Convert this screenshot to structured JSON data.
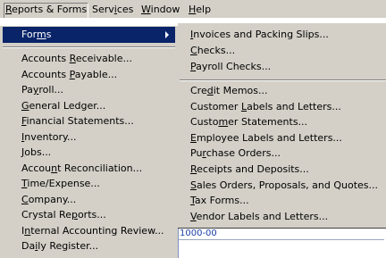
{
  "menubar": {
    "items": [
      {
        "label": "Reports & Forms",
        "underline_index": 0,
        "open": true
      },
      {
        "label": "Services",
        "underline_index": 4,
        "open": false
      },
      {
        "label": "Window",
        "underline_index": 0,
        "open": false
      },
      {
        "label": "Help",
        "underline_index": 0,
        "open": false
      }
    ]
  },
  "reports_menu": {
    "selected": {
      "label": "Forms",
      "underline_index": 3,
      "has_submenu": true
    },
    "items": [
      {
        "label": "Accounts Receivable...",
        "underline_index": 9
      },
      {
        "label": "Accounts Payable...",
        "underline_index": 9
      },
      {
        "label": "Payroll...",
        "underline_index": 2
      },
      {
        "label": "General Ledger...",
        "underline_index": 0
      },
      {
        "label": "Financial Statements...",
        "underline_index": 0
      },
      {
        "label": "Inventory...",
        "underline_index": 0
      },
      {
        "label": "Jobs...",
        "underline_index": 0
      },
      {
        "label": "Account Reconciliation...",
        "underline_index": 5
      },
      {
        "label": "Time/Expense...",
        "underline_index": 0
      },
      {
        "label": "Company...",
        "underline_index": 0
      },
      {
        "label": "Crystal Reports...",
        "underline_index": 10
      },
      {
        "label": "Internal Accounting Review...",
        "underline_index": 1
      },
      {
        "label": "Daily Register...",
        "underline_index": 2
      }
    ]
  },
  "forms_submenu": {
    "group1": [
      {
        "label": "Invoices and Packing Slips...",
        "underline_index": 0
      },
      {
        "label": "Checks...",
        "underline_index": 0
      },
      {
        "label": "Payroll Checks...",
        "underline_index": 0
      }
    ],
    "group2": [
      {
        "label": "Credit Memos...",
        "underline_index": 3
      },
      {
        "label": "Customer Labels and Letters...",
        "underline_index": 9
      },
      {
        "label": "Customer Statements...",
        "underline_index": 5
      },
      {
        "label": "Employee Labels and Letters...",
        "underline_index": 0
      },
      {
        "label": "Purchase Orders...",
        "underline_index": 2
      },
      {
        "label": "Receipts and Deposits...",
        "underline_index": 0
      },
      {
        "label": "Sales Orders, Proposals, and Quotes...",
        "underline_index": 0
      },
      {
        "label": "Tax Forms...",
        "underline_index": 0
      },
      {
        "label": "Vendor Labels and Letters...",
        "underline_index": 0
      }
    ]
  },
  "account_field": {
    "value": "1000-00"
  },
  "colors": {
    "menu_bg": "#d4d0c8",
    "highlight": "#0a246a",
    "highlight_text": "#ffffff",
    "account_text": "#1a3ea6"
  }
}
